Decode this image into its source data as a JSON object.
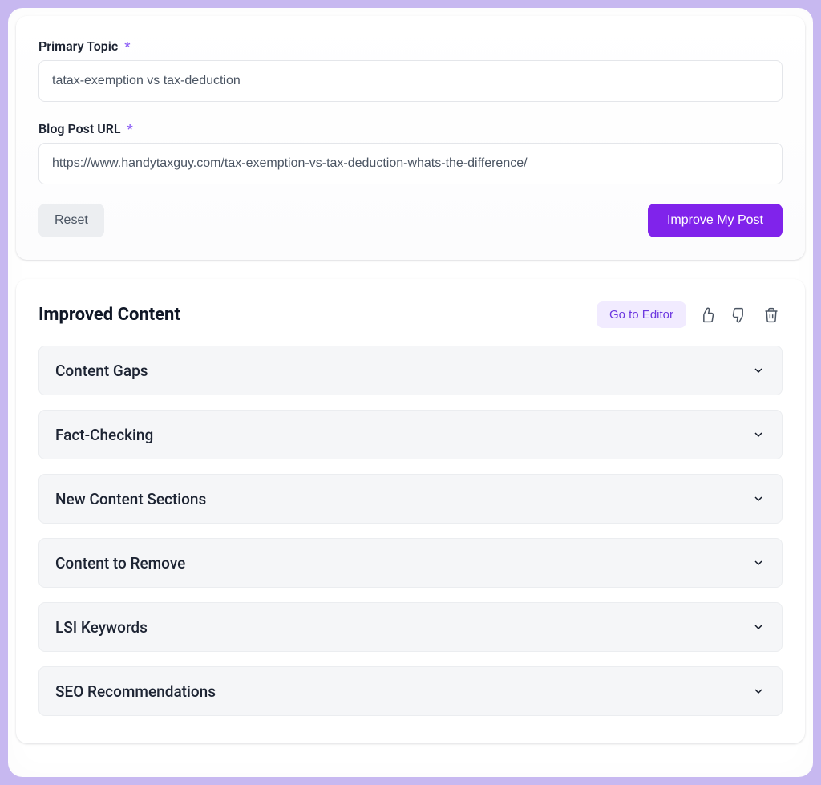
{
  "form": {
    "topic_label": "Primary Topic",
    "topic_value": "tatax-exemption vs tax-deduction",
    "url_label": "Blog Post URL",
    "url_value": "https://www.handytaxguy.com/tax-exemption-vs-tax-deduction-whats-the-difference/",
    "reset_label": "Reset",
    "submit_label": "Improve My Post",
    "required_mark": "*"
  },
  "results": {
    "title": "Improved Content",
    "editor_button": "Go to Editor",
    "sections": [
      {
        "title": "Content Gaps"
      },
      {
        "title": "Fact-Checking"
      },
      {
        "title": "New Content Sections"
      },
      {
        "title": "Content to Remove"
      },
      {
        "title": "LSI Keywords"
      },
      {
        "title": "SEO Recommendations"
      }
    ]
  }
}
